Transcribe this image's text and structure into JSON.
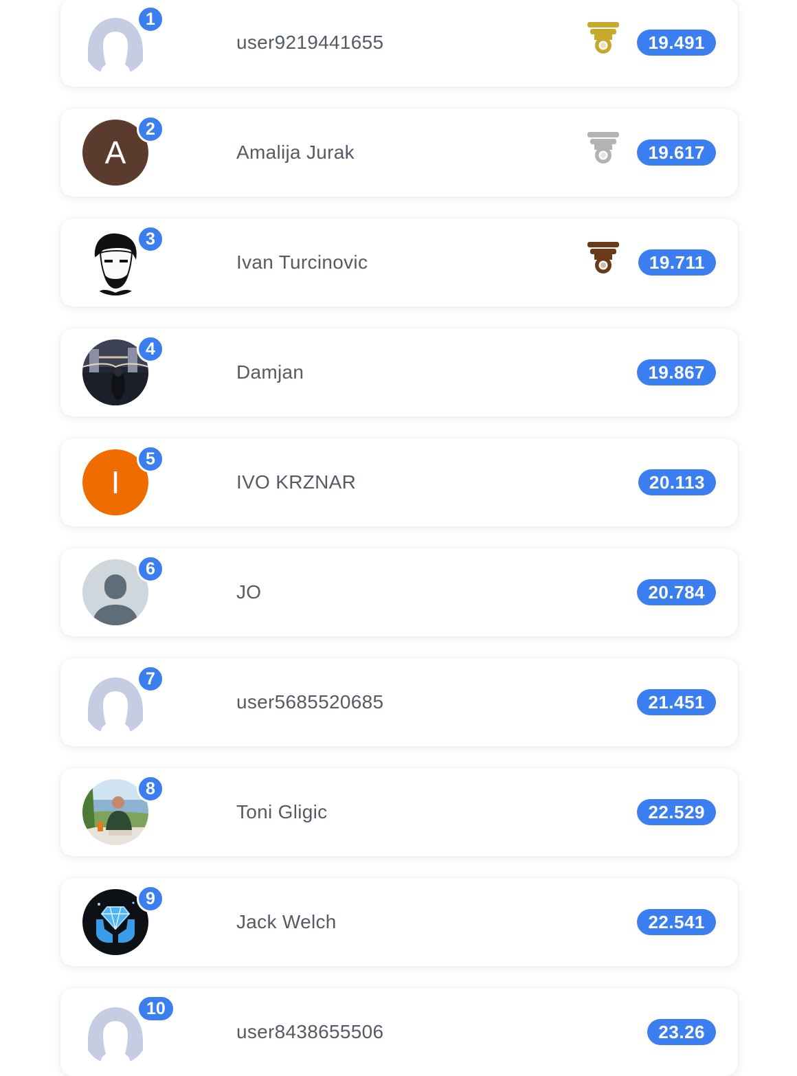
{
  "leaderboard": [
    {
      "rank": "1",
      "name": "user9219441655",
      "score": "19.491",
      "avatar": "placeholder-silhouette",
      "medal": "gold",
      "medal_color": "#c8a92b"
    },
    {
      "rank": "2",
      "name": "Amalija Jurak",
      "score": "19.617",
      "avatar": "letter",
      "avatar_letter": "A",
      "avatar_color": "#5a3b2e",
      "medal": "silver",
      "medal_color": "#b3b3b3"
    },
    {
      "rank": "3",
      "name": "Ivan Turcinovic",
      "score": "19.711",
      "avatar": "sketch-portrait",
      "medal": "bronze",
      "medal_color": "#6b3a17"
    },
    {
      "rank": "4",
      "name": "Damjan",
      "score": "19.867",
      "avatar": "photo-night-bridge"
    },
    {
      "rank": "5",
      "name": "IVO KRZNAR",
      "score": "20.113",
      "avatar": "letter",
      "avatar_letter": "I",
      "avatar_color": "#ee6c00"
    },
    {
      "rank": "6",
      "name": "JO",
      "score": "20.784",
      "avatar": "default-person"
    },
    {
      "rank": "7",
      "name": "user5685520685",
      "score": "21.451",
      "avatar": "placeholder-silhouette"
    },
    {
      "rank": "8",
      "name": "Toni Gligic",
      "score": "22.529",
      "avatar": "photo-terrace"
    },
    {
      "rank": "9",
      "name": "Jack Welch",
      "score": "22.541",
      "avatar": "diamond-hands"
    },
    {
      "rank": "10",
      "name": "user8438655506",
      "score": "23.26",
      "avatar": "placeholder-silhouette"
    }
  ],
  "colors": {
    "accent": "#3a7ef0",
    "name_text": "#545b66",
    "placeholder": "#c6cde3"
  }
}
